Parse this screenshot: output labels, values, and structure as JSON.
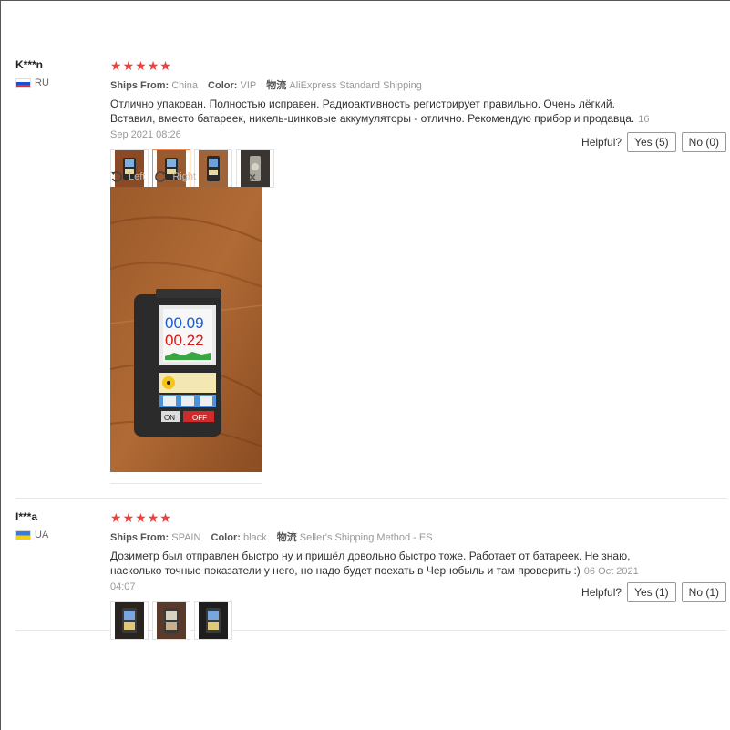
{
  "reviews": [
    {
      "user": "K***n",
      "country": "RU",
      "rating": 5,
      "ships_from_label": "Ships From:",
      "ships_from": "China",
      "color_label": "Color:",
      "color": "VIP",
      "logistics_label": "物流",
      "logistics": "AliExpress Standard Shipping",
      "text": "Отлично упакован. Полностью исправен. Радиоактивность регистрирует правильно. Очень лёгкий. Вставил, вместо батареек, никель-цинковые аккумуляторы - отлично. Рекомендую прибор и продавца.",
      "date": "16 Sep 2021 08:26",
      "helpful_label": "Helpful?",
      "yes_label": "Yes (5)",
      "no_label": "No (0)",
      "viewer": {
        "left_label": "Left",
        "right_label": "Right",
        "close": "×"
      },
      "meter_readings": [
        "00.09",
        "00.22"
      ],
      "meter_buttons": [
        "ON",
        "OFF"
      ]
    },
    {
      "user": "I***a",
      "country": "UA",
      "rating": 5,
      "ships_from_label": "Ships From:",
      "ships_from": "SPAIN",
      "color_label": "Color:",
      "color": "black",
      "logistics_label": "物流",
      "logistics": "Seller's Shipping Method - ES",
      "text": "Дозиметр был отправлен быстро ну и пришёл довольно быстро тоже. Работает от батареек. Не знаю, насколько точные показатели у него, но надо будет поехать в Чернобыль и там проверить :)",
      "date": "06 Oct 2021 04:07",
      "helpful_label": "Helpful?",
      "yes_label": "Yes (1)",
      "no_label": "No (1)"
    }
  ],
  "star_glyph": "★",
  "colors": {
    "star": "#f23d3d",
    "active_thumb": "#f08650"
  }
}
